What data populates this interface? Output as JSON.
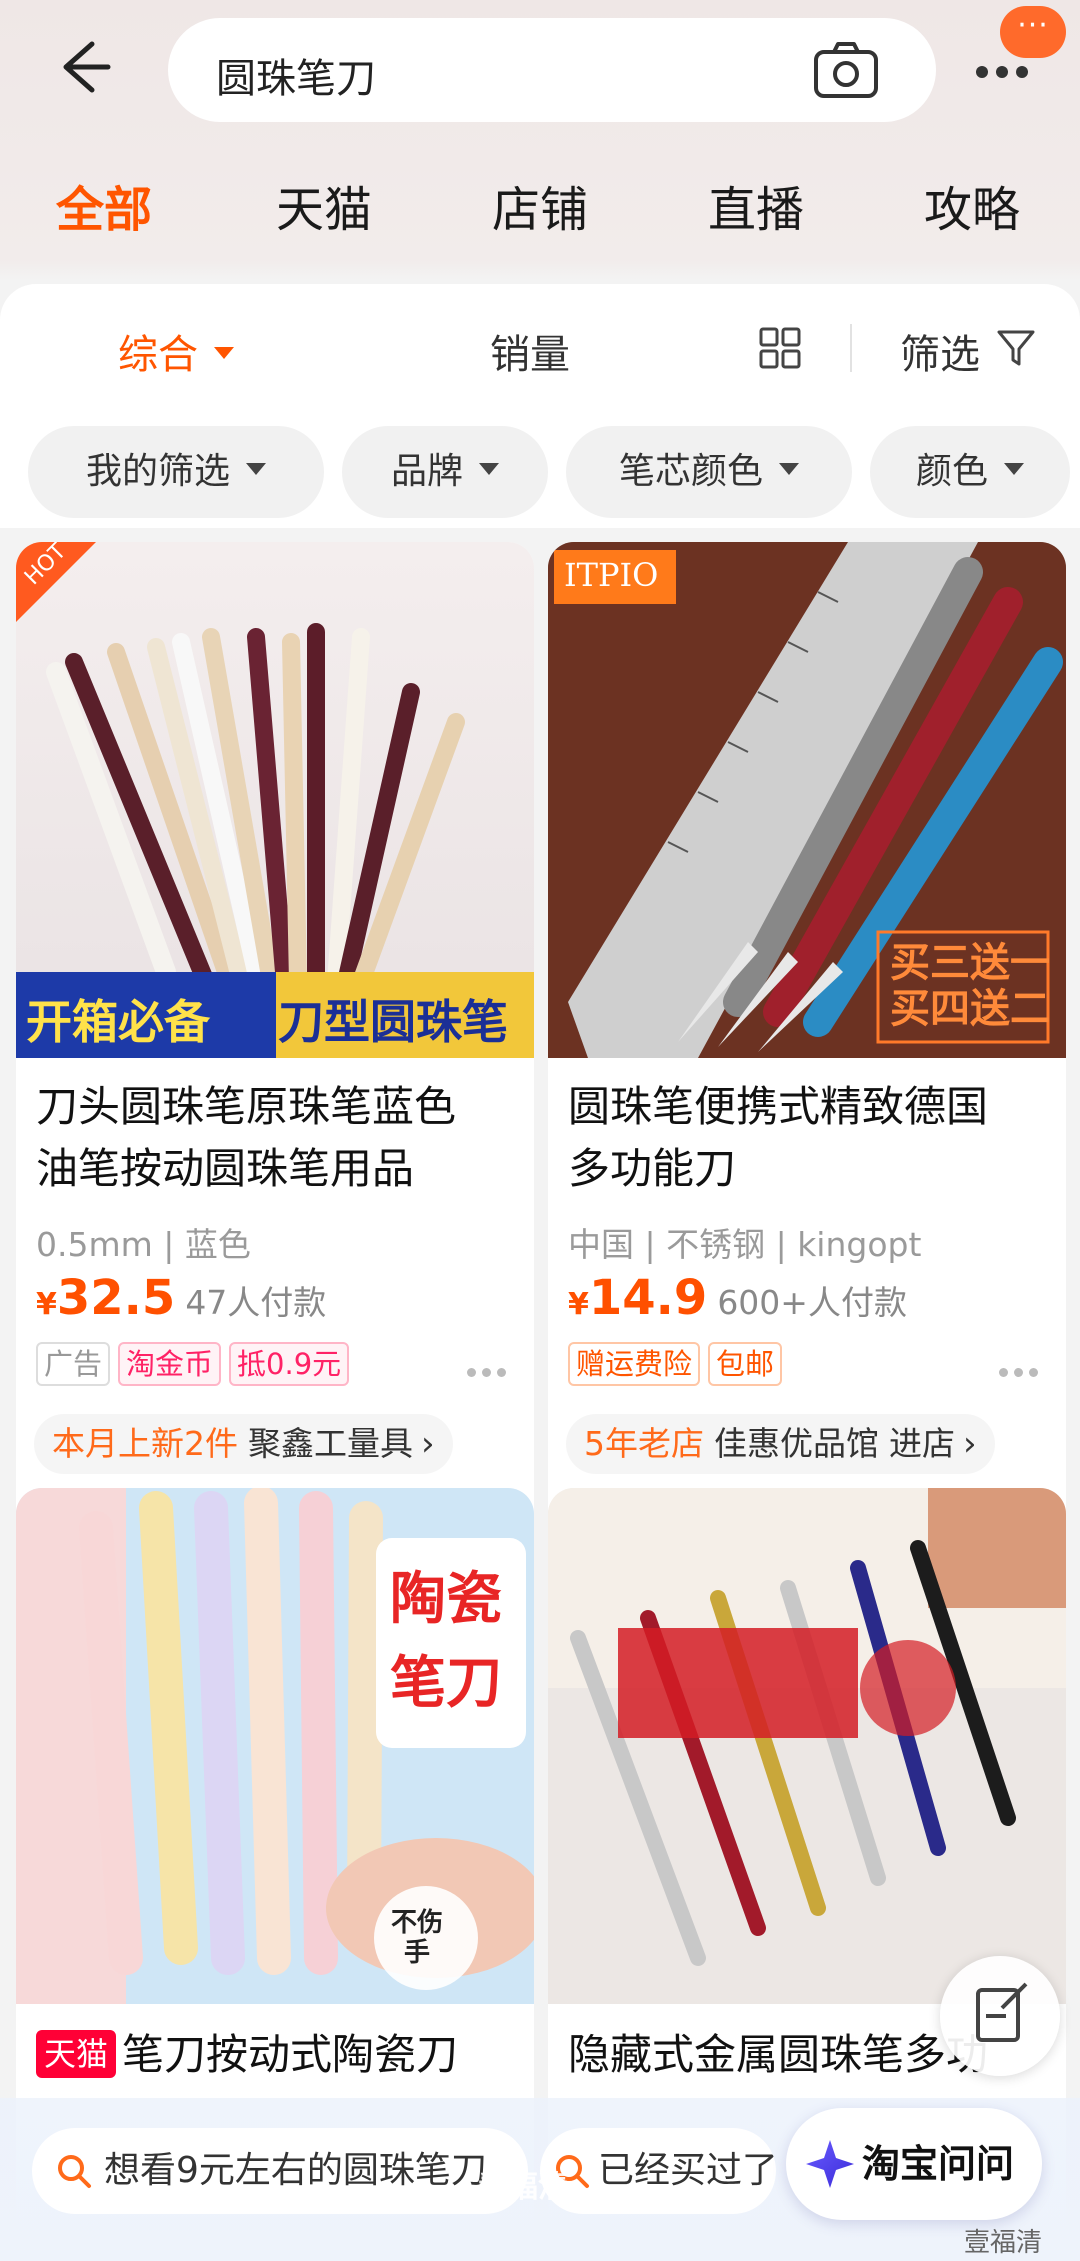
{
  "search": {
    "query": "圆珠笔刀",
    "message_badge": "···"
  },
  "tabs": [
    "全部",
    "天猫",
    "店铺",
    "直播",
    "攻略"
  ],
  "sort": {
    "overall": "综合",
    "sales": "销量",
    "filter": "筛选"
  },
  "chips": [
    "我的筛选",
    "品牌",
    "笔芯颜色",
    "颜色"
  ],
  "products": [
    {
      "badge": "HOT",
      "banner_left": "开箱必备",
      "banner_right": "刀型圆珠笔",
      "title_line1": "刀头圆珠笔原珠笔蓝色",
      "title_line2": "油笔按动圆珠笔用品",
      "spec": "0.5mm | 蓝色",
      "currency": "¥",
      "price": "32.5",
      "sold": "47人付款",
      "tags": [
        "广告",
        "淘金币",
        "抵0.9元"
      ],
      "shop_highlight": "本月上新2件",
      "shop_name": "聚鑫工量具"
    },
    {
      "badge": "ITPIO",
      "promo_line1": "买三送一",
      "promo_line2": "买四送二",
      "title_line1": "圆珠笔便携式精致德国",
      "title_line2": "多功能刀",
      "spec": "中国 | 不锈钢 | kingopt",
      "currency": "¥",
      "price": "14.9",
      "sold": "600+人付款",
      "tags": [
        "赠运费险",
        "包邮"
      ],
      "shop_highlight": "5年老店",
      "shop_name": "佳惠优品馆",
      "shop_action": "进店"
    },
    {
      "image_text_line1": "陶瓷",
      "image_text_line2": "笔刀",
      "badge_text": "不伤手",
      "store_badge": "天猫",
      "title_line1": "笔刀按动式陶瓷刀"
    },
    {
      "title_line1": "隐藏式金属圆珠笔多功"
    }
  ],
  "bottom": {
    "suggestion_1": "想看9元左右的圆珠笔刀",
    "suggestion_2": "已经买过了",
    "ask_label": "淘宝问问",
    "watermark_1": "看福清",
    "watermark_2": "壹福清"
  },
  "colors": {
    "accent": "#ff5500",
    "price": "#ff5000",
    "tmall_red": "#ff0036"
  }
}
